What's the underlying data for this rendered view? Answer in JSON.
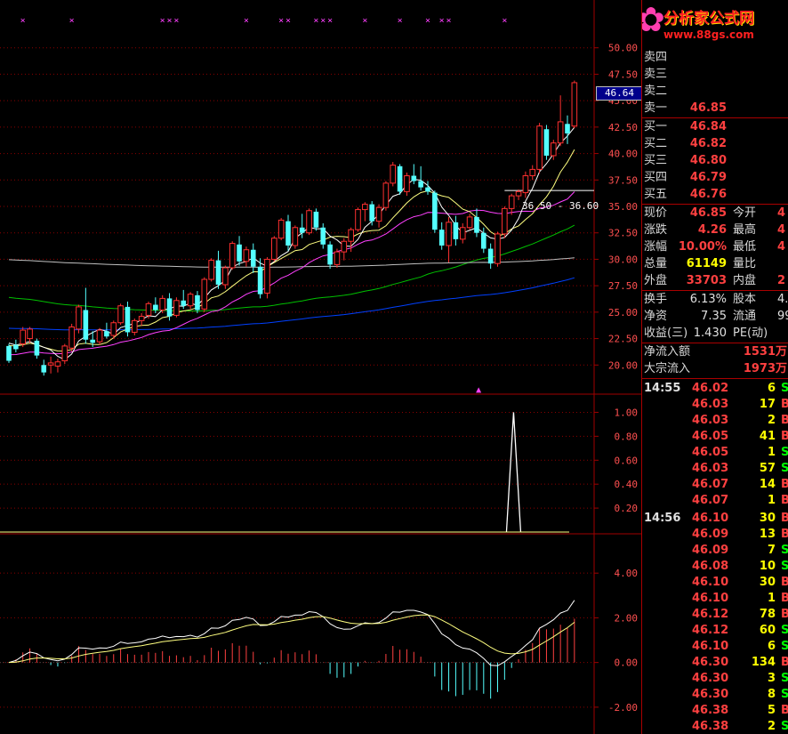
{
  "colors": {
    "background": "#000000",
    "grid": "#8b0000",
    "axis_text": "#ff5050",
    "candle_up": "#ff3030",
    "candle_down": "#54ffff",
    "ma5": "#ffffff",
    "ma10": "#ffff80",
    "ma20": "#ff40ff",
    "ma60": "#00c000",
    "ma120": "#0040ff",
    "ma250": "#c0c0c0",
    "marker": "#ff40ff"
  },
  "logo": {
    "name": "分析家公式网",
    "url": "www.88gs.com",
    "flower_icon": "flower-icon"
  },
  "cursor_price_label": "46.64",
  "range_annotation": "36.50 - 36.60",
  "quote": {
    "asks": [
      {
        "label": "卖四",
        "price": ""
      },
      {
        "label": "卖三",
        "price": ""
      },
      {
        "label": "卖二",
        "price": ""
      },
      {
        "label": "卖一",
        "price": "46.85"
      }
    ],
    "bids": [
      {
        "label": "买一",
        "price": "46.84"
      },
      {
        "label": "买二",
        "price": "46.82"
      },
      {
        "label": "买三",
        "price": "46.80"
      },
      {
        "label": "买四",
        "price": "46.79"
      },
      {
        "label": "买五",
        "price": "46.76"
      }
    ],
    "stats": [
      {
        "l1": "现价",
        "v1": "46.85",
        "l2": "今开",
        "v2": "4",
        "v1_yellow": false
      },
      {
        "l1": "涨跌",
        "v1": "4.26",
        "l2": "最高",
        "v2": "4",
        "v1_yellow": false
      },
      {
        "l1": "涨幅",
        "v1": "10.00%",
        "l2": "最低",
        "v2": "4",
        "v1_yellow": false
      },
      {
        "l1": "总量",
        "v1": "61149",
        "l2": "量比",
        "v2": "",
        "v1_yellow": true
      },
      {
        "l1": "外盘",
        "v1": "33703",
        "l2": "内盘",
        "v2": "2",
        "v1_yellow": false
      }
    ],
    "fund": [
      {
        "l1": "换手",
        "v1": "6.13%",
        "l2": "股本",
        "v2": "4."
      },
      {
        "l1": "净资",
        "v1": "7.35",
        "l2": "流通",
        "v2": "99"
      },
      {
        "l1": "收益(三)",
        "v1": "1.430",
        "l2": "PE(动)",
        "v2": ""
      }
    ],
    "flows": [
      {
        "label": "净流入额",
        "value": "1531万"
      },
      {
        "label": "大宗流入",
        "value": "1973万"
      }
    ]
  },
  "ticks": [
    {
      "time": "14:55",
      "price": "46.02",
      "vol": "6",
      "bs": "S"
    },
    {
      "time": "",
      "price": "46.03",
      "vol": "17",
      "bs": "B"
    },
    {
      "time": "",
      "price": "46.03",
      "vol": "2",
      "bs": "B"
    },
    {
      "time": "",
      "price": "46.05",
      "vol": "41",
      "bs": "B"
    },
    {
      "time": "",
      "price": "46.05",
      "vol": "1",
      "bs": "S"
    },
    {
      "time": "",
      "price": "46.03",
      "vol": "57",
      "bs": "S"
    },
    {
      "time": "",
      "price": "46.07",
      "vol": "14",
      "bs": "B"
    },
    {
      "time": "",
      "price": "46.07",
      "vol": "1",
      "bs": "B"
    },
    {
      "time": "14:56",
      "price": "46.10",
      "vol": "30",
      "bs": "B"
    },
    {
      "time": "",
      "price": "46.09",
      "vol": "13",
      "bs": "B"
    },
    {
      "time": "",
      "price": "46.09",
      "vol": "7",
      "bs": "S"
    },
    {
      "time": "",
      "price": "46.08",
      "vol": "10",
      "bs": "S"
    },
    {
      "time": "",
      "price": "46.10",
      "vol": "30",
      "bs": "B"
    },
    {
      "time": "",
      "price": "46.10",
      "vol": "1",
      "bs": "B"
    },
    {
      "time": "",
      "price": "46.12",
      "vol": "78",
      "bs": "B"
    },
    {
      "time": "",
      "price": "46.12",
      "vol": "60",
      "bs": "S"
    },
    {
      "time": "",
      "price": "46.10",
      "vol": "6",
      "bs": "S"
    },
    {
      "time": "",
      "price": "46.30",
      "vol": "134",
      "bs": "B"
    },
    {
      "time": "",
      "price": "46.30",
      "vol": "3",
      "bs": "S"
    },
    {
      "time": "",
      "price": "46.30",
      "vol": "8",
      "bs": "S"
    },
    {
      "time": "",
      "price": "46.38",
      "vol": "5",
      "bs": "B"
    },
    {
      "time": "",
      "price": "46.38",
      "vol": "2",
      "bs": "S"
    }
  ],
  "chart_data": [
    {
      "type": "candlestick",
      "panel": "price",
      "ylim": [
        17.5,
        52.5
      ],
      "y_ticks": [
        "50.00",
        "47.50",
        "45.00",
        "42.50",
        "40.00",
        "37.50",
        "35.00",
        "32.50",
        "30.00",
        "27.50",
        "25.00",
        "22.50",
        "20.00"
      ],
      "candles": [
        {
          "o": 21.8,
          "h": 22.0,
          "l": 20.2,
          "c": 20.4
        },
        {
          "o": 21.9,
          "h": 22.4,
          "l": 21.2,
          "c": 21.5
        },
        {
          "o": 22.0,
          "h": 23.6,
          "l": 21.7,
          "c": 23.3
        },
        {
          "o": 22.5,
          "h": 23.6,
          "l": 22.1,
          "c": 23.4
        },
        {
          "o": 22.3,
          "h": 22.5,
          "l": 20.6,
          "c": 20.9
        },
        {
          "o": 20.0,
          "h": 20.5,
          "l": 19.0,
          "c": 19.3
        },
        {
          "o": 20.0,
          "h": 20.8,
          "l": 19.2,
          "c": 20.2
        },
        {
          "o": 19.9,
          "h": 20.6,
          "l": 19.3,
          "c": 20.3
        },
        {
          "o": 20.4,
          "h": 22.0,
          "l": 20.1,
          "c": 21.8
        },
        {
          "o": 21.6,
          "h": 23.9,
          "l": 21.3,
          "c": 23.6
        },
        {
          "o": 23.4,
          "h": 25.7,
          "l": 23.0,
          "c": 25.5
        },
        {
          "o": 25.2,
          "h": 27.3,
          "l": 22.0,
          "c": 22.4
        },
        {
          "o": 22.4,
          "h": 23.2,
          "l": 21.7,
          "c": 22.1
        },
        {
          "o": 22.2,
          "h": 23.5,
          "l": 21.9,
          "c": 23.3
        },
        {
          "o": 23.2,
          "h": 24.0,
          "l": 22.5,
          "c": 22.7
        },
        {
          "o": 22.8,
          "h": 24.2,
          "l": 22.5,
          "c": 24.0
        },
        {
          "o": 24.0,
          "h": 25.8,
          "l": 23.8,
          "c": 25.6
        },
        {
          "o": 25.5,
          "h": 26.0,
          "l": 22.7,
          "c": 23.1
        },
        {
          "o": 23.1,
          "h": 24.4,
          "l": 22.8,
          "c": 24.2
        },
        {
          "o": 24.2,
          "h": 24.9,
          "l": 23.7,
          "c": 24.6
        },
        {
          "o": 24.7,
          "h": 26.0,
          "l": 24.4,
          "c": 25.8
        },
        {
          "o": 25.7,
          "h": 26.4,
          "l": 24.9,
          "c": 25.2
        },
        {
          "o": 25.2,
          "h": 26.6,
          "l": 24.9,
          "c": 26.3
        },
        {
          "o": 26.3,
          "h": 26.8,
          "l": 24.2,
          "c": 24.6
        },
        {
          "o": 24.7,
          "h": 26.4,
          "l": 24.5,
          "c": 26.1
        },
        {
          "o": 26.1,
          "h": 27.1,
          "l": 25.3,
          "c": 25.6
        },
        {
          "o": 25.6,
          "h": 26.9,
          "l": 25.3,
          "c": 26.7
        },
        {
          "o": 26.6,
          "h": 27.0,
          "l": 24.9,
          "c": 25.2
        },
        {
          "o": 25.3,
          "h": 28.3,
          "l": 25.0,
          "c": 28.1
        },
        {
          "o": 28.1,
          "h": 30.1,
          "l": 27.9,
          "c": 29.9
        },
        {
          "o": 29.9,
          "h": 30.8,
          "l": 27.2,
          "c": 27.6
        },
        {
          "o": 27.6,
          "h": 29.4,
          "l": 27.2,
          "c": 29.2
        },
        {
          "o": 29.2,
          "h": 31.7,
          "l": 29.0,
          "c": 31.5
        },
        {
          "o": 31.4,
          "h": 32.2,
          "l": 29.4,
          "c": 29.8
        },
        {
          "o": 29.8,
          "h": 31.2,
          "l": 29.3,
          "c": 30.9
        },
        {
          "o": 30.9,
          "h": 31.5,
          "l": 28.7,
          "c": 29.3
        },
        {
          "o": 29.3,
          "h": 30.1,
          "l": 26.3,
          "c": 26.7
        },
        {
          "o": 26.8,
          "h": 30.2,
          "l": 26.3,
          "c": 30.0
        },
        {
          "o": 30.0,
          "h": 32.2,
          "l": 29.8,
          "c": 32.0
        },
        {
          "o": 32.0,
          "h": 33.9,
          "l": 31.8,
          "c": 33.7
        },
        {
          "o": 33.6,
          "h": 34.2,
          "l": 30.8,
          "c": 31.3
        },
        {
          "o": 31.3,
          "h": 33.2,
          "l": 31.0,
          "c": 33.0
        },
        {
          "o": 33.0,
          "h": 34.3,
          "l": 32.0,
          "c": 32.5
        },
        {
          "o": 32.5,
          "h": 34.8,
          "l": 32.3,
          "c": 34.6
        },
        {
          "o": 34.5,
          "h": 34.8,
          "l": 32.7,
          "c": 33.0
        },
        {
          "o": 33.0,
          "h": 33.4,
          "l": 31.0,
          "c": 31.4
        },
        {
          "o": 31.4,
          "h": 31.7,
          "l": 29.1,
          "c": 29.5
        },
        {
          "o": 29.5,
          "h": 31.0,
          "l": 29.2,
          "c": 30.7
        },
        {
          "o": 30.7,
          "h": 32.0,
          "l": 29.9,
          "c": 31.7
        },
        {
          "o": 31.7,
          "h": 33.0,
          "l": 30.7,
          "c": 32.8
        },
        {
          "o": 32.8,
          "h": 34.9,
          "l": 32.6,
          "c": 34.7
        },
        {
          "o": 34.7,
          "h": 35.4,
          "l": 33.6,
          "c": 35.2
        },
        {
          "o": 35.2,
          "h": 35.5,
          "l": 33.2,
          "c": 33.6
        },
        {
          "o": 33.6,
          "h": 35.2,
          "l": 33.0,
          "c": 34.9
        },
        {
          "o": 34.9,
          "h": 37.4,
          "l": 34.6,
          "c": 37.2
        },
        {
          "o": 37.2,
          "h": 39.2,
          "l": 36.9,
          "c": 38.9
        },
        {
          "o": 38.8,
          "h": 39.0,
          "l": 36.1,
          "c": 36.4
        },
        {
          "o": 36.4,
          "h": 38.2,
          "l": 36.0,
          "c": 37.9
        },
        {
          "o": 37.9,
          "h": 39.0,
          "l": 37.1,
          "c": 37.4
        },
        {
          "o": 37.4,
          "h": 38.8,
          "l": 36.5,
          "c": 36.8
        },
        {
          "o": 36.8,
          "h": 37.4,
          "l": 36.1,
          "c": 36.4
        },
        {
          "o": 36.3,
          "h": 36.5,
          "l": 32.5,
          "c": 32.8
        },
        {
          "o": 32.8,
          "h": 33.5,
          "l": 30.9,
          "c": 31.3
        },
        {
          "o": 31.3,
          "h": 34.0,
          "l": 29.7,
          "c": 33.5
        },
        {
          "o": 33.5,
          "h": 34.1,
          "l": 31.3,
          "c": 31.9
        },
        {
          "o": 31.9,
          "h": 33.4,
          "l": 31.5,
          "c": 33.0
        },
        {
          "o": 33.0,
          "h": 34.3,
          "l": 32.8,
          "c": 34.0
        },
        {
          "o": 34.0,
          "h": 34.8,
          "l": 32.1,
          "c": 32.5
        },
        {
          "o": 32.5,
          "h": 33.0,
          "l": 30.6,
          "c": 31.0
        },
        {
          "o": 31.0,
          "h": 31.5,
          "l": 29.1,
          "c": 29.6
        },
        {
          "o": 29.6,
          "h": 32.6,
          "l": 29.3,
          "c": 32.4
        },
        {
          "o": 32.4,
          "h": 35.0,
          "l": 32.0,
          "c": 34.8
        },
        {
          "o": 34.8,
          "h": 36.2,
          "l": 34.2,
          "c": 36.0
        },
        {
          "o": 36.0,
          "h": 36.6,
          "l": 35.6,
          "c": 36.4
        },
        {
          "o": 36.3,
          "h": 38.3,
          "l": 35.8,
          "c": 37.9
        },
        {
          "o": 37.9,
          "h": 38.9,
          "l": 37.5,
          "c": 38.5
        },
        {
          "o": 38.5,
          "h": 42.9,
          "l": 38.1,
          "c": 42.6
        },
        {
          "o": 42.3,
          "h": 42.7,
          "l": 39.4,
          "c": 39.8
        },
        {
          "o": 39.8,
          "h": 41.3,
          "l": 39.4,
          "c": 41.0
        },
        {
          "o": 41.0,
          "h": 45.5,
          "l": 40.7,
          "c": 43.0
        },
        {
          "o": 42.8,
          "h": 43.6,
          "l": 40.9,
          "c": 41.9
        },
        {
          "o": 42.6,
          "h": 46.9,
          "l": 42.4,
          "c": 46.7
        }
      ],
      "markers_x_index": [
        2,
        9,
        22,
        23,
        24,
        34,
        39,
        40,
        44,
        45,
        46,
        51,
        56,
        60,
        62,
        63,
        71
      ],
      "bottom_marker_index": 52
    },
    {
      "type": "area",
      "panel": "indicator",
      "ylim": [
        0,
        1.1
      ],
      "y_ticks": [
        "1.00",
        "0.80",
        "0.60",
        "0.40",
        "0.20"
      ],
      "spike_index": 57,
      "spike_value": 1.0
    },
    {
      "type": "bar",
      "panel": "macd",
      "ylim": [
        -3.2,
        5.6
      ],
      "y_ticks": [
        "4.00",
        "2.00",
        "0.00",
        "-2.00"
      ]
    }
  ]
}
